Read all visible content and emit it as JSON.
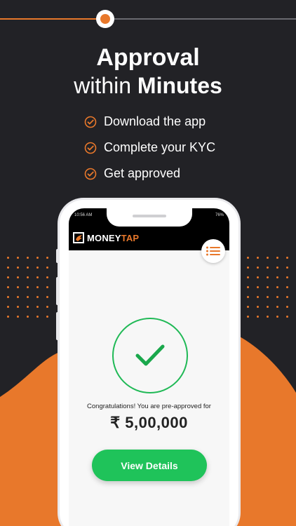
{
  "progress": {
    "step_index": 1,
    "accent": "#e8782b"
  },
  "headline": {
    "line1": "Approval",
    "line2_prefix": "within ",
    "line2_bold": "Minutes"
  },
  "features": [
    {
      "icon": "check-circle-icon",
      "label": "Download the app"
    },
    {
      "icon": "check-circle-icon",
      "label": "Complete your KYC"
    },
    {
      "icon": "check-circle-icon",
      "label": "Get approved"
    }
  ],
  "phone": {
    "status_time": "10:56 AM",
    "status_right": "76%",
    "brand_main": "MONEY",
    "brand_accent": "TAP",
    "menu_icon": "list-icon",
    "success_icon": "checkmark-icon",
    "congrats_text": "Congratulations! You are pre-approved for",
    "amount": "₹ 5,00,000",
    "cta_label": "View Details"
  },
  "colors": {
    "background": "#222226",
    "accent": "#e8782b",
    "success": "#1fc35a"
  }
}
